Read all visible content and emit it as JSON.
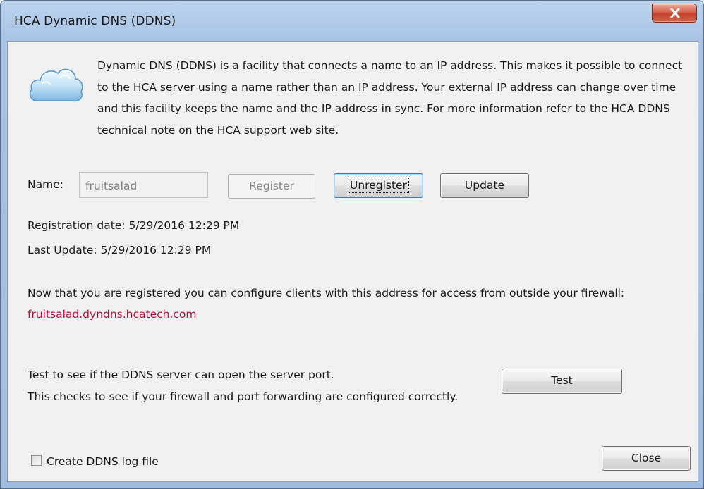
{
  "window": {
    "title": "HCA Dynamic DNS (DDNS)"
  },
  "intro": {
    "icon": "cloud-icon",
    "text": "Dynamic DNS (DDNS) is a facility that connects a name to an IP address. This makes it possible to connect to the HCA server using a name rather than an IP address. Your external IP address can change over time and this facility keeps the name and the IP address in sync. For more information refer to the HCA DDNS technical note on the HCA support web site."
  },
  "registration": {
    "name_label": "Name:",
    "name_value": "fruitsalad",
    "register_label": "Register",
    "unregister_label": "Unregister",
    "update_label": "Update",
    "registration_date": "Registration date: 5/29/2016 12:29 PM",
    "last_update": "Last Update: 5/29/2016 12:29 PM"
  },
  "address": {
    "info": "Now that you are registered you can configure clients with this address for access from outside your firewall:",
    "hostname": "fruitsalad.dyndns.hcatech.com",
    "hostname_color": "#b1163c"
  },
  "test": {
    "line1": "Test to see if the DDNS server can open the server port.",
    "line2": "This checks to see if your firewall and port forwarding are configured correctly.",
    "button_label": "Test"
  },
  "footer": {
    "log_checkbox_label": "Create DDNS log file",
    "log_checked": false,
    "close_label": "Close"
  }
}
